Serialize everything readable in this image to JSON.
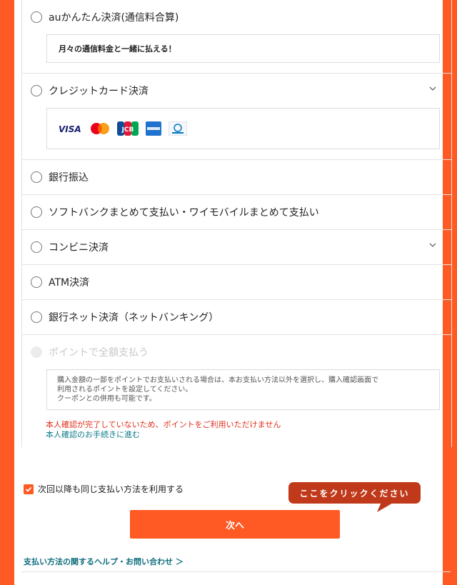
{
  "payment": {
    "au": {
      "label": "auかんたん決済(通信料合算)",
      "note": "月々の通信料金と一緒に払える！"
    },
    "credit": {
      "label": "クレジットカード決済",
      "brands": [
        "visa-logo",
        "mastercard-logo",
        "jcb-logo",
        "amex-logo",
        "diners-club-logo"
      ]
    },
    "bank_transfer": {
      "label": "銀行振込"
    },
    "carrier": {
      "label": "ソフトバンクまとめて支払い・ワイモバイルまとめて支払い"
    },
    "convenience": {
      "label": "コンビニ決済"
    },
    "atm": {
      "label": "ATM決済"
    },
    "net_bank": {
      "label": "銀行ネット決済（ネットバンキング）"
    },
    "points": {
      "label": "ポイントで全額支払う",
      "note_lines": [
        "購入金額の一部をポイントでお支払いされる場合は、本お支払い方法以外を選択し、購入確認画面で",
        "利用されるポイントを設定してください。",
        "クーポンとの併用も可能です。"
      ],
      "warning": "本人確認が完了していないため、ポイントをご利用いただけません",
      "verify_link": "本人確認のお手続きに進む"
    }
  },
  "save_method": {
    "label": "次回以降も同じ支払い方法を利用する",
    "checked": true
  },
  "tooltip": "ここをクリックください",
  "next_button": "次へ",
  "help_link": "支払い方法の関するヘルプ・お問い合わせ ＞",
  "colors": {
    "accent": "#ff5a24",
    "tooltip": "#c0391a",
    "warning": "#e0301e",
    "link": "#0f7c8a"
  }
}
